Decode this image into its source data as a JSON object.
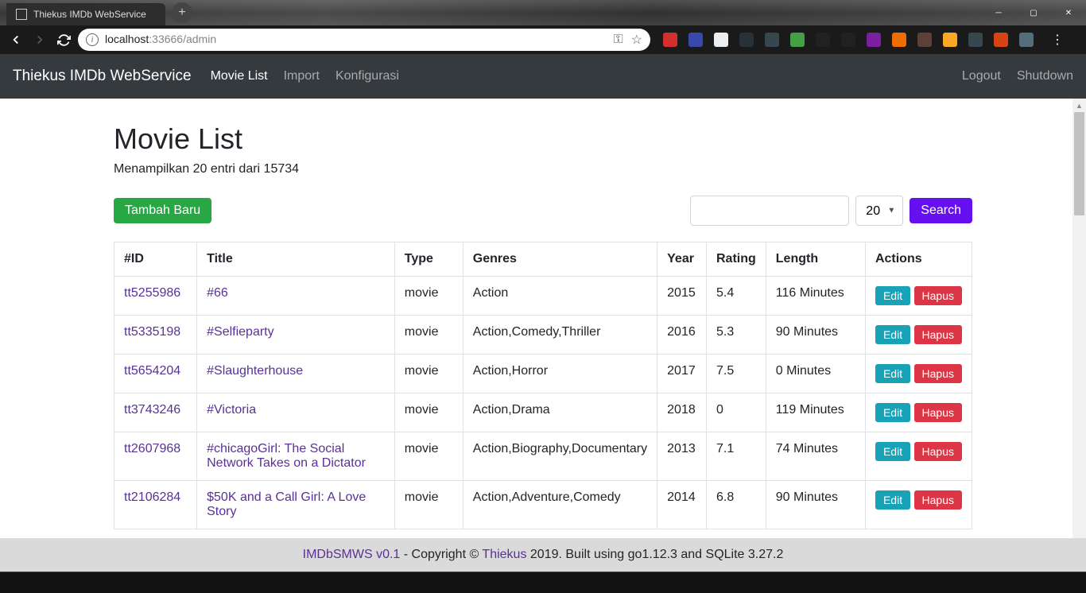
{
  "browser": {
    "tab_title": "Thiekus IMDb WebService",
    "url_host": "localhost",
    "url_rest": ":33666/admin"
  },
  "navbar": {
    "brand": "Thiekus IMDb WebService",
    "links": [
      "Movie List",
      "Import",
      "Konfigurasi"
    ],
    "right_links": [
      "Logout",
      "Shutdown"
    ]
  },
  "page": {
    "title": "Movie List",
    "subtitle": "Menampilkan 20 entri dari 15734",
    "add_button": "Tambah Baru",
    "search_button": "Search",
    "page_size": "20"
  },
  "table": {
    "headers": [
      "#ID",
      "Title",
      "Type",
      "Genres",
      "Year",
      "Rating",
      "Length",
      "Actions"
    ],
    "edit_label": "Edit",
    "delete_label": "Hapus",
    "rows": [
      {
        "id": "tt5255986",
        "title": "#66",
        "type": "movie",
        "genres": "Action",
        "year": "2015",
        "rating": "5.4",
        "length": "116 Minutes"
      },
      {
        "id": "tt5335198",
        "title": "#Selfieparty",
        "type": "movie",
        "genres": "Action,Comedy,Thriller",
        "year": "2016",
        "rating": "5.3",
        "length": "90 Minutes"
      },
      {
        "id": "tt5654204",
        "title": "#Slaughterhouse",
        "type": "movie",
        "genres": "Action,Horror",
        "year": "2017",
        "rating": "7.5",
        "length": "0 Minutes"
      },
      {
        "id": "tt3743246",
        "title": "#Victoria",
        "type": "movie",
        "genres": "Action,Drama",
        "year": "2018",
        "rating": "0",
        "length": "119 Minutes"
      },
      {
        "id": "tt2607968",
        "title": "#chicagoGirl: The Social Network Takes on a Dictator",
        "type": "movie",
        "genres": "Action,Biography,Documentary",
        "year": "2013",
        "rating": "7.1",
        "length": "74 Minutes"
      },
      {
        "id": "tt2106284",
        "title": "$50K and a Call Girl: A Love Story",
        "type": "movie",
        "genres": "Action,Adventure,Comedy",
        "year": "2014",
        "rating": "6.8",
        "length": "90 Minutes"
      }
    ]
  },
  "footer": {
    "app": "IMDbSMWS v0.1",
    "mid": " - Copyright © ",
    "author": "Thiekus",
    "tail": " 2019. Built using go1.12.3 and SQLite 3.27.2"
  },
  "ext_colors": [
    "#d32f2f",
    "#3949ab",
    "#eceff1",
    "#263238",
    "#37474f",
    "#43a047",
    "#212121",
    "#212121",
    "#7b1fa2",
    "#ef6c00",
    "#5d4037",
    "#f9a825",
    "#37474f",
    "#d84315",
    "#546e7a"
  ]
}
